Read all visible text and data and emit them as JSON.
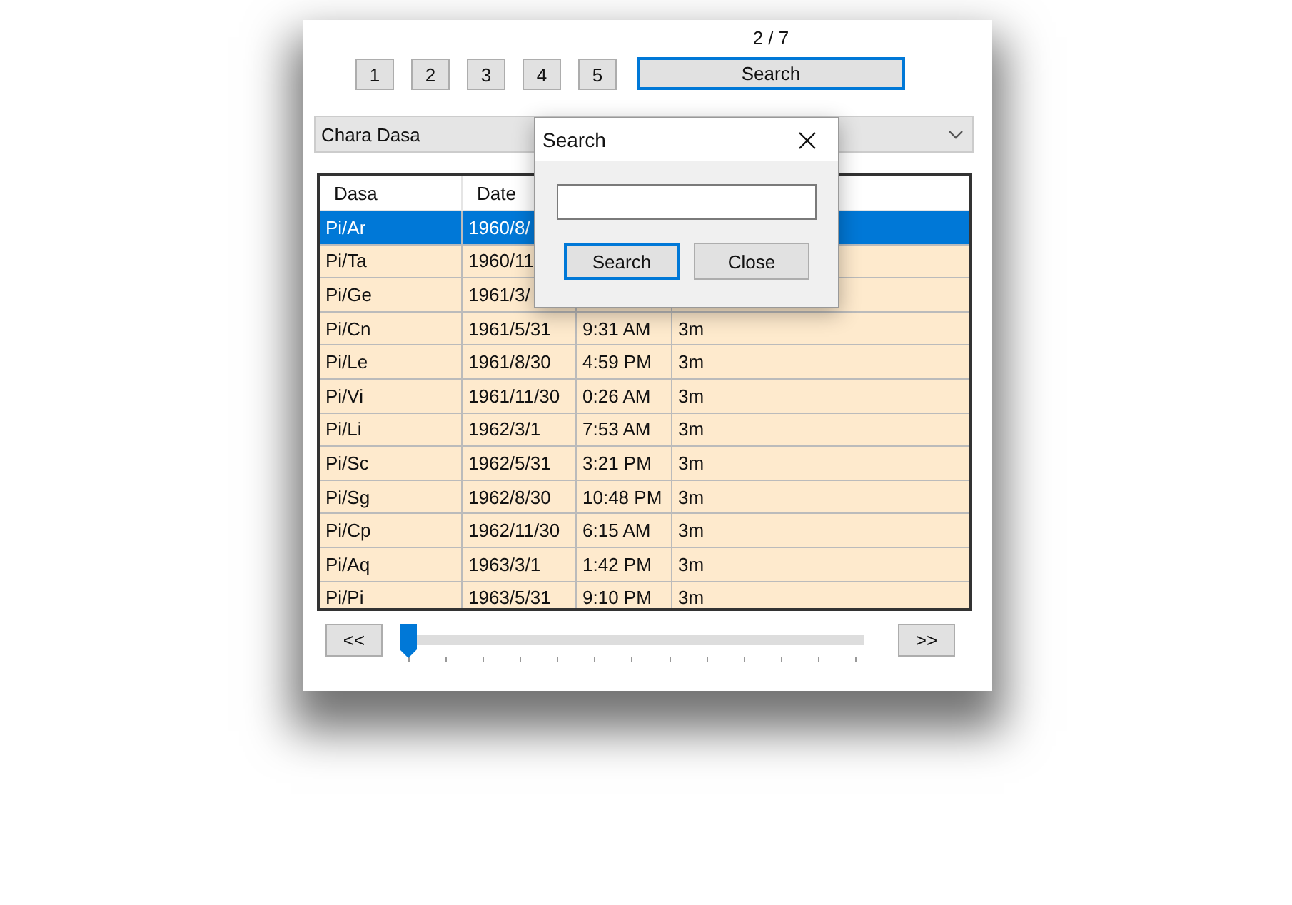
{
  "page_indicator": "2 / 7",
  "page_buttons": [
    "1",
    "2",
    "3",
    "4",
    "5"
  ],
  "search_button": {
    "label": "Search",
    "focused": true
  },
  "dasa_dropdown": {
    "value": "Chara Dasa"
  },
  "table": {
    "columns": [
      "Dasa",
      "Date"
    ],
    "rows": [
      {
        "dasa": "Pi/Ar",
        "date": "1960/8/",
        "selected": true
      },
      {
        "dasa": "Pi/Ta",
        "date": "1960/11",
        "selected": false
      },
      {
        "dasa": "Pi/Ge",
        "date": "1961/3/",
        "selected": false
      },
      {
        "dasa": "Pi/Cn",
        "date": "1961/5/31",
        "time": "9:31 AM",
        "length": "3m",
        "selected": false
      },
      {
        "dasa": "Pi/Le",
        "date": "1961/8/30",
        "time": "4:59 PM",
        "length": "3m",
        "selected": false
      },
      {
        "dasa": "Pi/Vi",
        "date": "1961/11/30",
        "time": "0:26 AM",
        "length": "3m",
        "selected": false
      },
      {
        "dasa": "Pi/Li",
        "date": "1962/3/1",
        "time": "7:53 AM",
        "length": "3m",
        "selected": false
      },
      {
        "dasa": "Pi/Sc",
        "date": "1962/5/31",
        "time": "3:21 PM",
        "length": "3m",
        "selected": false
      },
      {
        "dasa": "Pi/Sg",
        "date": "1962/8/30",
        "time": "10:48 PM",
        "length": "3m",
        "selected": false
      },
      {
        "dasa": "Pi/Cp",
        "date": "1962/11/30",
        "time": "6:15 AM",
        "length": "3m",
        "selected": false
      },
      {
        "dasa": "Pi/Aq",
        "date": "1963/3/1",
        "time": "1:42 PM",
        "length": "3m",
        "selected": false
      },
      {
        "dasa": "Pi/Pi",
        "date": "1963/5/31",
        "time": "9:10 PM",
        "length": "3m",
        "selected": false
      }
    ]
  },
  "prev_button": "<<",
  "next_button": ">>",
  "slider": {
    "level": 0
  },
  "search_dialog": {
    "title": "Search",
    "search_button": {
      "label": "Search",
      "focused": true
    },
    "close_button": "Close"
  }
}
